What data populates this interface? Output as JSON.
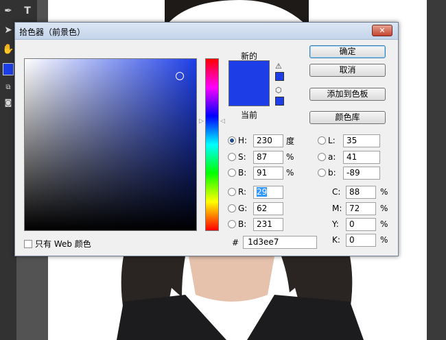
{
  "dialog": {
    "title": "拾色器（前景色）",
    "close_label": "✕",
    "labels": {
      "new": "新的",
      "current": "当前"
    },
    "colors": {
      "new": "#1d3ee7",
      "current": "#1d3ee7"
    },
    "buttons": {
      "ok": "确定",
      "cancel": "取消",
      "add_swatch": "添加到色板",
      "color_library": "颜色库"
    },
    "only_web_colors": {
      "label": "只有 Web 颜色",
      "checked": false
    },
    "hsb": {
      "h": {
        "label": "H:",
        "value": "230",
        "unit": "度",
        "selected": true
      },
      "s": {
        "label": "S:",
        "value": "87",
        "unit": "%"
      },
      "b": {
        "label": "B:",
        "value": "91",
        "unit": "%"
      }
    },
    "rgb": {
      "r": {
        "label": "R:",
        "value": "29"
      },
      "g": {
        "label": "G:",
        "value": "62"
      },
      "b": {
        "label": "B:",
        "value": "231"
      }
    },
    "lab": {
      "l": {
        "label": "L:",
        "value": "35"
      },
      "a": {
        "label": "a:",
        "value": "41"
      },
      "b": {
        "label": "b:",
        "value": "-89"
      }
    },
    "cmyk": {
      "c": {
        "label": "C:",
        "value": "88",
        "unit": "%"
      },
      "m": {
        "label": "M:",
        "value": "72",
        "unit": "%"
      },
      "y": {
        "label": "Y:",
        "value": "0",
        "unit": "%"
      },
      "k": {
        "label": "K:",
        "value": "0",
        "unit": "%"
      }
    },
    "hex": {
      "label": "#",
      "value": "1d3ee7"
    }
  },
  "toolbar": {
    "text_tool_label": "T",
    "foreground_color": "#1d3ee7"
  }
}
